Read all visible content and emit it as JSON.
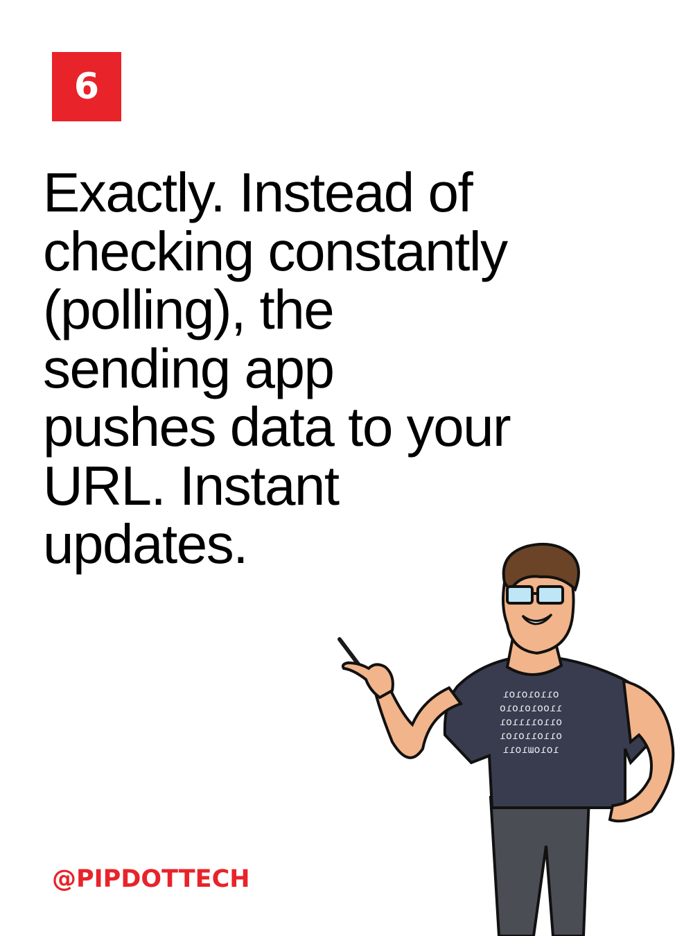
{
  "slide": {
    "number": "6"
  },
  "body": {
    "text": "Exactly. Instead of checking constantly (polling), the sending app pushes data to your URL. Instant updates."
  },
  "footer": {
    "handle": "@PIPDOTTECH"
  },
  "mascot": {
    "shirt_print": [
      "ɾoɾoɾoɾɾo",
      "oɾoɾoɾooɾɾ",
      "ɾoɾɾɾɾoɾɾo",
      "ɾoɾoɾɾoɾɾo",
      "ɾɾoɾɯoɾoɾ"
    ]
  },
  "colors": {
    "accent": "#e8232a",
    "text": "#000000",
    "background": "#ffffff"
  }
}
